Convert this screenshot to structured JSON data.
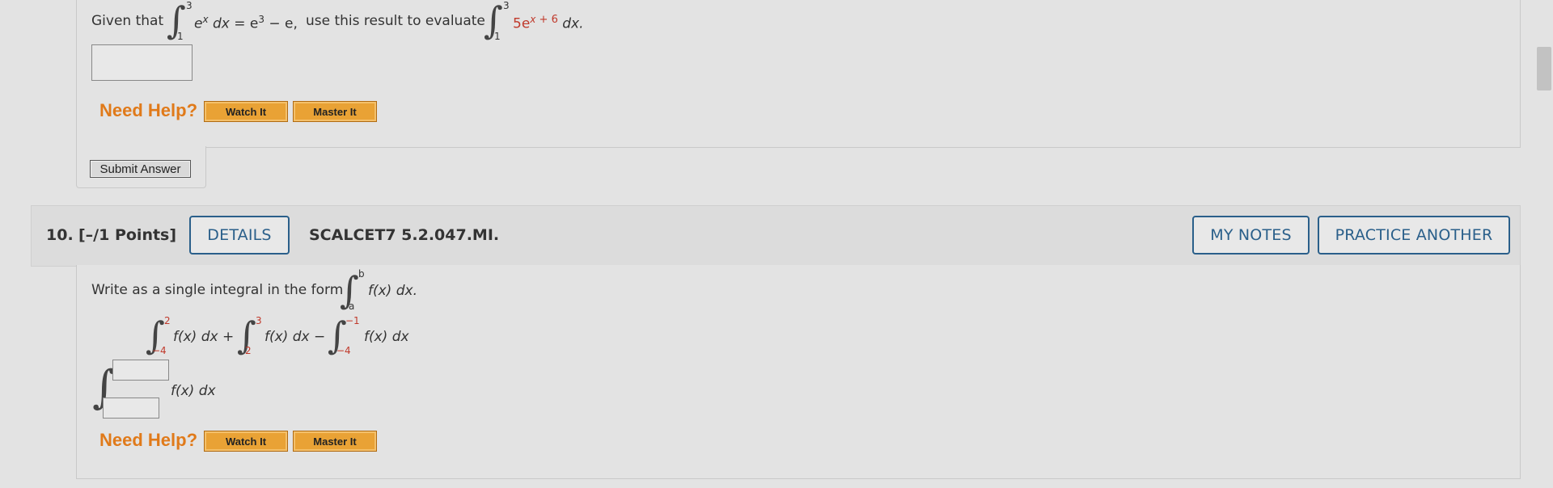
{
  "q9": {
    "given_text": "Given that",
    "int1": {
      "upper": "3",
      "lower": "1",
      "integrand": "e",
      "sup": "x",
      "dx": "dx",
      "equals": "= e",
      "rhs_sup": "3",
      "rhs_rest": " − e,"
    },
    "use_text": "use this result to evaluate",
    "int2": {
      "upper": "3",
      "lower": "1",
      "coef": "5e",
      "sup": "x",
      "plus": " + ",
      "const": "6",
      "dx": " dx."
    },
    "need_help": "Need Help?",
    "watch_it": "Watch It",
    "master_it": "Master It",
    "submit": "Submit Answer"
  },
  "q10": {
    "number": "10.",
    "points": "[–/1 Points]",
    "details": "DETAILS",
    "code": "SCALCET7 5.2.047.MI.",
    "my_notes": "MY NOTES",
    "practice_another": "PRACTICE ANOTHER",
    "prompt": "Write as a single integral in the form",
    "form": {
      "upper": "b",
      "lower": "a",
      "integrand": "f(x) dx."
    },
    "expr": [
      {
        "upper": "2",
        "lower": "−4",
        "integrand": "f(x) dx +"
      },
      {
        "upper": "3",
        "lower": "2",
        "integrand": "f(x) dx −"
      },
      {
        "upper": "−1",
        "lower": "−4",
        "integrand": "f(x) dx"
      }
    ],
    "answer_integrand": "f(x) dx",
    "answer_upper_value": "",
    "answer_lower_value": "",
    "need_help": "Need Help?",
    "watch_it": "Watch It",
    "master_it": "Master It"
  },
  "colors": {
    "accent": "#2a5f8a",
    "orange": "#e9a235",
    "help": "#e07a1a",
    "limit_red": "#c0392b"
  }
}
